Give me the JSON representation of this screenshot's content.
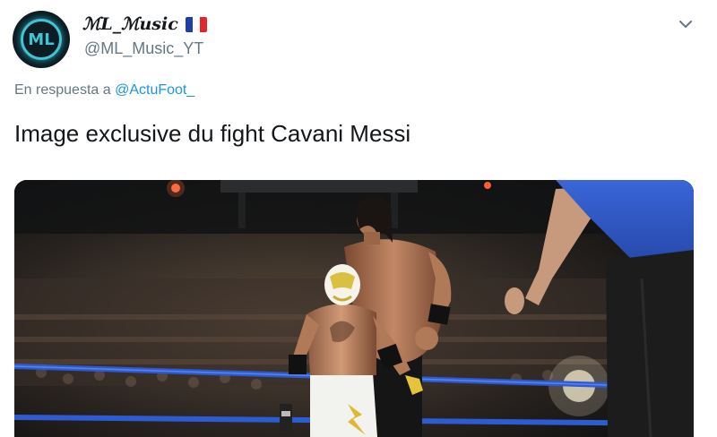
{
  "tweet": {
    "avatar_text": "ML",
    "display_name": "ℳL_ℳusic",
    "flag_icon": "france-flag-icon",
    "handle": "@ML_Music_YT",
    "reply_prefix": "En respuesta a",
    "reply_to": "@ActuFoot_",
    "text": "Image exclusive du fight Cavani Messi",
    "menu_icon": "chevron-down-icon"
  },
  "colors": {
    "link": "#1b95e0",
    "secondary_text": "#657786",
    "primary_text": "#14171a",
    "avatar_accent": "#3fc4d4",
    "ring_ropes": "#2d5bd1"
  }
}
